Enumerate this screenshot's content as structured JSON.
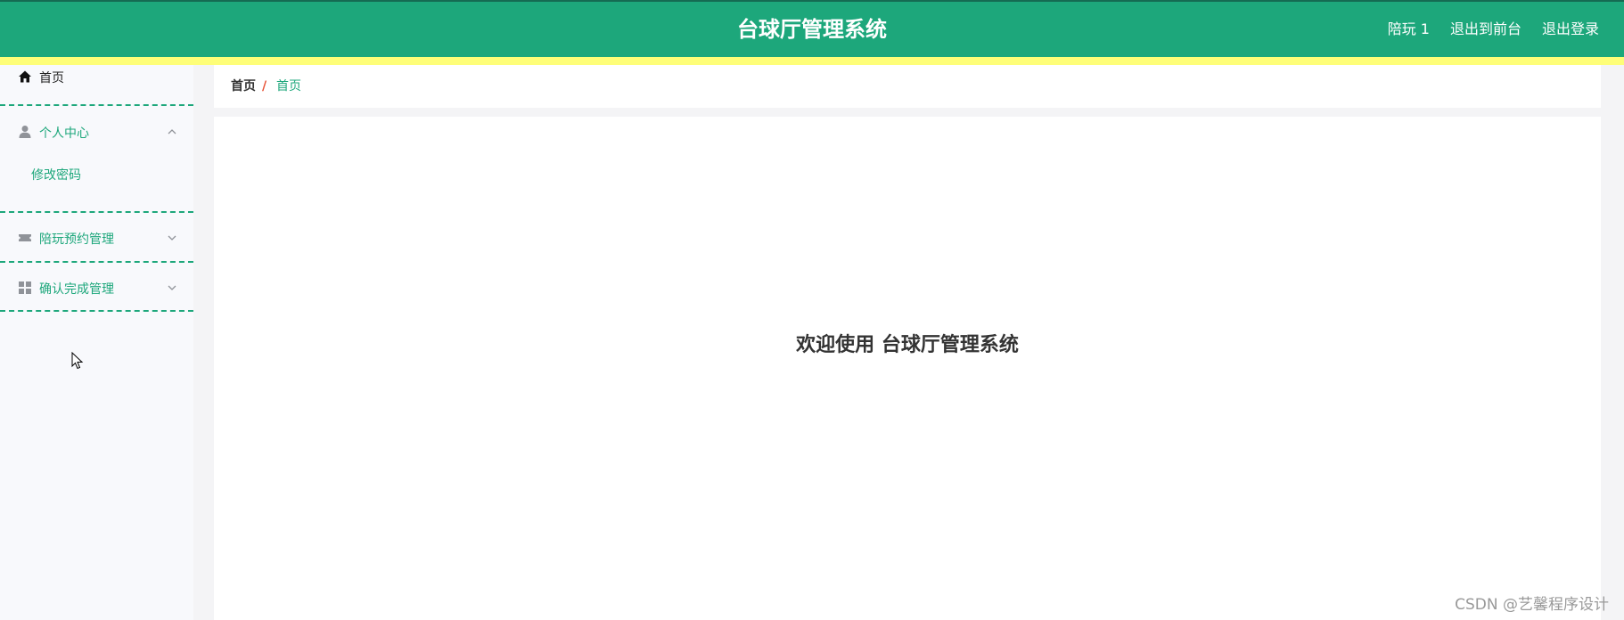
{
  "header": {
    "app_title": "台球厅管理系统",
    "user_label": "陪玩 1",
    "back_to_front": "退出到前台",
    "logout": "退出登录"
  },
  "sidebar": {
    "items": [
      {
        "label": "首页",
        "icon": "home-icon"
      },
      {
        "label": "个人中心",
        "icon": "user-icon",
        "expanded": true,
        "children": [
          {
            "label": "修改密码"
          }
        ]
      },
      {
        "label": "陪玩预约管理",
        "icon": "ticket-icon",
        "expanded": false
      },
      {
        "label": "确认完成管理",
        "icon": "grid-icon",
        "expanded": false
      }
    ]
  },
  "breadcrumb": {
    "items": [
      "首页",
      "首页"
    ],
    "separator": "/"
  },
  "main": {
    "welcome": "欢迎使用 台球厅管理系统"
  },
  "watermark": "CSDN @艺馨程序设计",
  "colors": {
    "primary": "#1da77b",
    "stripe": "#fefe78",
    "breadcrumb_separator": "#e8573b",
    "sidebar_bg": "#f8f9fc"
  }
}
